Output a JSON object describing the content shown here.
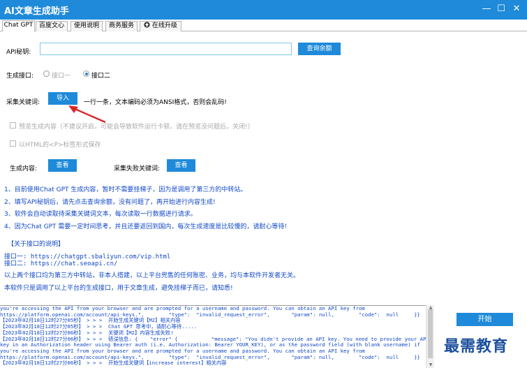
{
  "window": {
    "title": "AI文章生成助手",
    "minimize_glyph": "—",
    "maximize_glyph": "☐",
    "close_glyph": "✕"
  },
  "tabs": [
    {
      "label": "Chat GPT",
      "active": true
    },
    {
      "label": "百度文心",
      "active": false
    },
    {
      "label": "使用说明",
      "active": false
    },
    {
      "label": "商务服务",
      "active": false
    },
    {
      "label": "在线升级",
      "active": false
    }
  ],
  "form": {
    "api_key_label": "API秘钥:",
    "api_key_value": "",
    "query_balance_button": "查询余额",
    "interface_label": "生成接口:",
    "interface_options": [
      {
        "label": "接口一",
        "selected": false
      },
      {
        "label": "接口二",
        "selected": true
      }
    ],
    "keyword_label": "采集关键词:",
    "import_button": "导入",
    "import_hint": "一行一条，文本编码必须为ANSI格式，否则会乱码!",
    "preview_checkbox": "预览生成内容（不建议开启，可能会导致软件运行卡顿，请在预览没问题后，关闭!）",
    "html_checkbox": "以HTML的<P>标签形式保存",
    "content_label": "生成内容:",
    "view_button_1": "查看",
    "failed_label": "采集失败关键词:",
    "view_button_2": "查看"
  },
  "notes": [
    "1、目前使用Chat GPT 生成内容，暂时不需要挂梯子，因为是调用了第三方的中转站。",
    "2、填写API秘钥后，请先点击查询余额，没有问题了，再开始进行内容生成!",
    "3、软件会自动读取待采集关键词文本，每次读取一行数据进行请求。",
    "4、因为Chat GPT 需要一定时间思考，并且还要返回到国内，每次生成速度是比较慢的，请耐心等待!"
  ],
  "interface_info": {
    "heading": "【关于接口的说明】",
    "line1": "接口一: https://chatgpt.sbaliyun.com/vip.html",
    "line2": "接口二: https://chat.seoapi.cn/",
    "note1": "以上两个接口均为第三方中转站，非本人搭建，以上平台兜售的任何账密、业务，均与本软件开发者无关。",
    "note2": "本软件只是调用了以上平台的生成接口，用于文章生成，避免挂梯子而已，请知悉!"
  },
  "log": [
    "you're accessing the API from your browser and are prompted for a username and password. You can obtain an API key from",
    "https://platform.openai.com/account/api-keys.\",        \"type\":  \"invalid_request_error\",       \"param\": null,        \"code\":  null     }}",
    "【2023年02月18日12时27分05秒】 > > >  开始生成关键词【M2】相关内容",
    "【2023年02月18日12时27分05秒】 > > >  Chat GPT 思考中，请耐心等待.....",
    "【2023年02月18日12时27分06秒】 > > >  关键词【M2】内容生成失败!",
    "【2023年02月18日12时27分06秒】 > > >  错误信息: {    \"error\" {           \"message\": \"You didn't provide an API key. You need to provide your API",
    "key in an Authorization header using Bearer auth (i.e. Authorization: Bearer YOUR_KEY), or as the password field (with blank username) if",
    "you're accessing the API from your browser and are prompted for a username and password. You can obtain an API key from",
    "https://platform.openai.com/account/api-keys.\",        \"type\":  \"invalid_request_error\",       \"param\": null,        \"code\":  null     }}",
    "【2023年02月18日12时27分06秒】 > > >  开始生成关键词【increase interest】相关内容"
  ],
  "start_button": "开始",
  "watermark": "最需教育",
  "colors": {
    "titlebar": "#1e8ad9",
    "button": "#1e8ad9",
    "log_text": "#1048c8",
    "arrow": "#d9262a"
  }
}
